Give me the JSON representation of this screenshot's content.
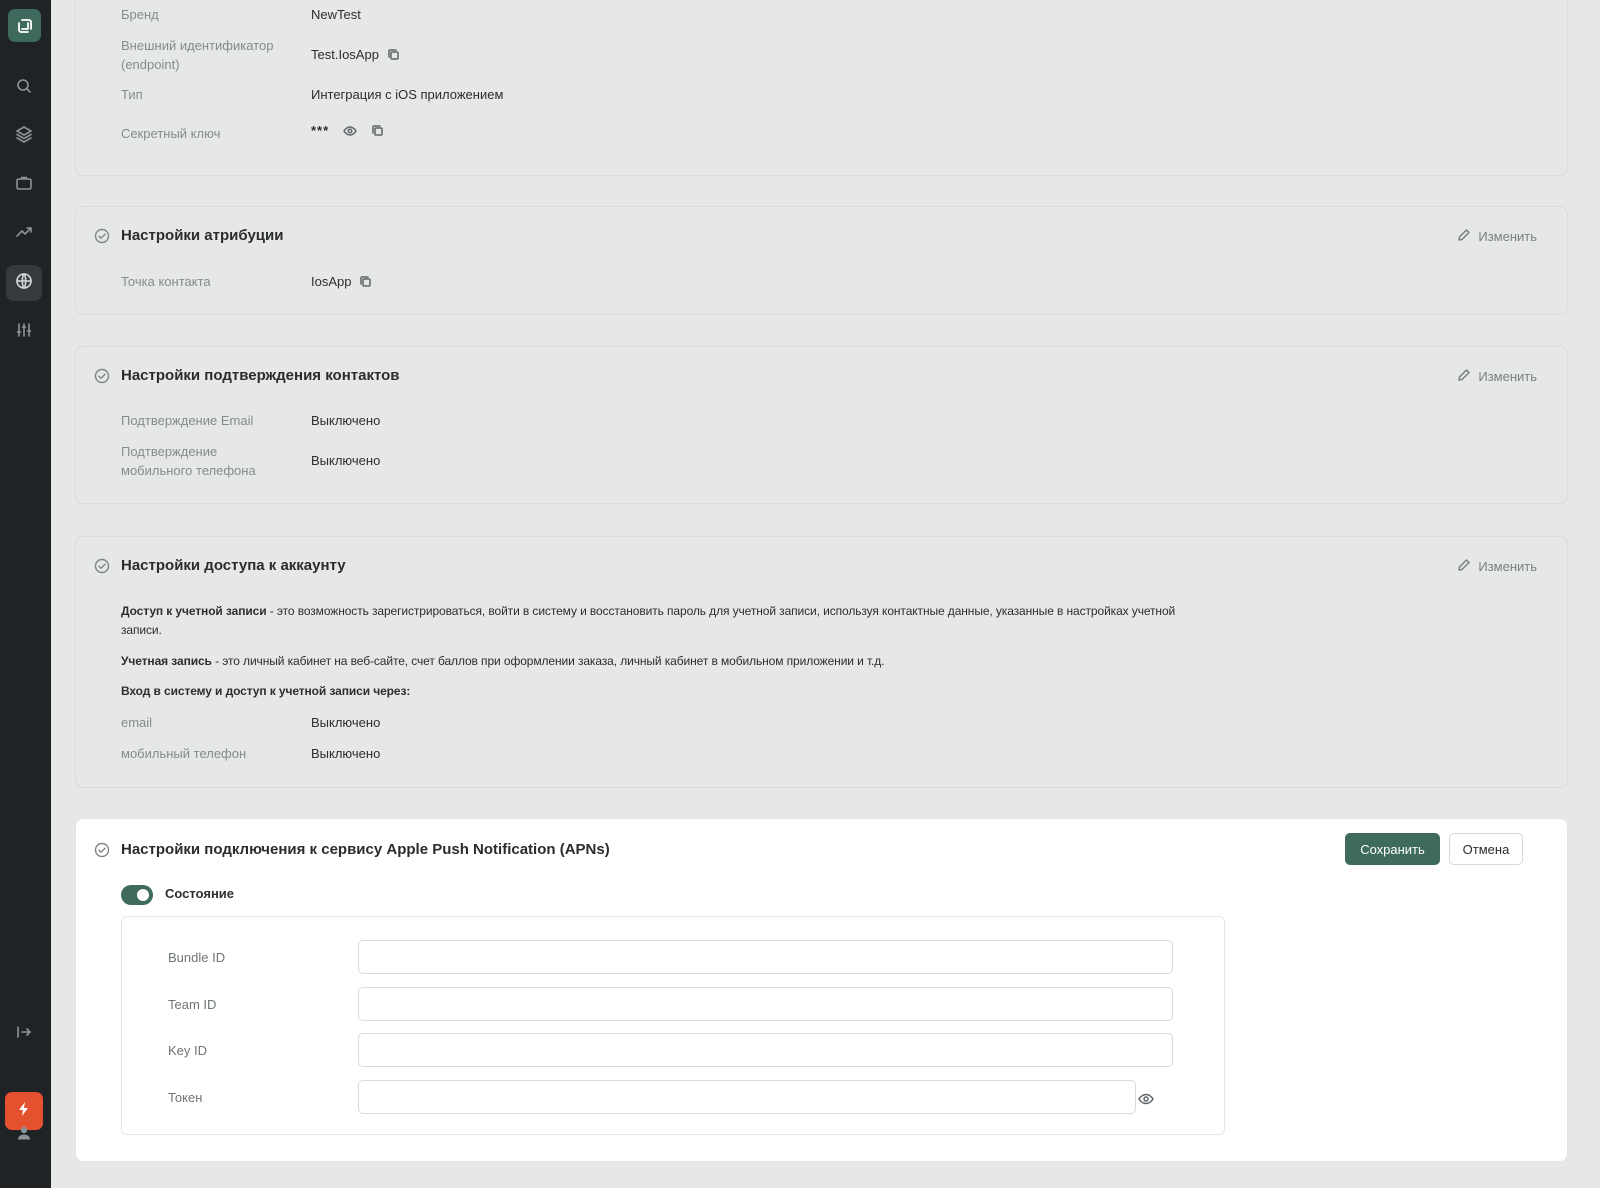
{
  "info": {
    "rows": [
      {
        "label": "Бренд",
        "value": "NewTest"
      },
      {
        "label": "Внешний идентификатор (endpoint)",
        "value": "Test.IosApp"
      },
      {
        "label": "Тип",
        "value": "Интеграция с iOS приложением"
      },
      {
        "label": "Секретный ключ",
        "value": "***"
      }
    ]
  },
  "attribution": {
    "title": "Настройки атрибуции",
    "edit_label": "Изменить",
    "rows": [
      {
        "label": "Точка контакта",
        "value": "IosApp"
      }
    ]
  },
  "contact_confirm": {
    "title": "Настройки подтверждения контактов",
    "edit_label": "Изменить",
    "rows": [
      {
        "label": "Подтверждение Email",
        "value": "Выключено"
      },
      {
        "label": "Подтверждение мобильного телефона",
        "value": "Выключено"
      }
    ]
  },
  "account_access": {
    "title": "Настройки доступа к аккаунту",
    "edit_label": "Изменить",
    "desc1_bold": "Доступ к учетной записи",
    "desc1_text": " - это возможность зарегистрироваться, войти в систему и восстановить пароль для учетной записи, используя контактные данные, указанные в настройках учетной записи.",
    "desc2_bold": "Учетная запись",
    "desc2_text": " - это личный кабинет на веб-сайте, счет баллов при оформлении заказа, личный кабинет в мобильном приложении и т.д.",
    "desc3_bold": "Вход в систему и доступ к учетной записи через:",
    "rows": [
      {
        "label": "email",
        "value": "Выключено"
      },
      {
        "label": "мобильный телефон",
        "value": "Выключено"
      }
    ]
  },
  "apns": {
    "title": "Настройки подключения к сервису Apple Push Notification (APNs)",
    "save_label": "Сохранить",
    "cancel_label": "Отмена",
    "toggle_label": "Состояние",
    "toggle_on": true,
    "fields": [
      {
        "label": "Bundle ID",
        "value": ""
      },
      {
        "label": "Team ID",
        "value": ""
      },
      {
        "label": "Key ID",
        "value": ""
      },
      {
        "label": "Токен",
        "value": ""
      }
    ]
  },
  "colors": {
    "accent": "#3f6b5d",
    "sidebar": "#1f2326",
    "quick_action": "#e4512e"
  },
  "icons": [
    "logo-icon",
    "search-icon",
    "layers-icon",
    "briefcase-icon",
    "trending-up-icon",
    "globe-icon",
    "sliders-icon",
    "logout-icon",
    "bolt-icon",
    "user-icon",
    "copy-icon",
    "eye-icon",
    "check-circle-icon",
    "pencil-icon"
  ]
}
